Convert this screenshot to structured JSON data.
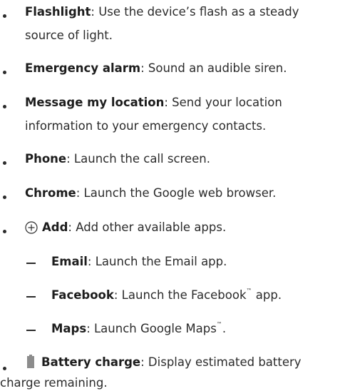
{
  "items": [
    {
      "term": "Flashlight",
      "desc_line1": ": Use the device’s flash as a steady",
      "desc_line2": "source of light."
    },
    {
      "term": "Emergency alarm",
      "desc_line1": ": Sound an audible siren."
    },
    {
      "term": "Message my location",
      "desc_line1": ": Send your location",
      "desc_line2": "information to your emergency contacts."
    },
    {
      "term": "Phone",
      "desc_line1": ": Launch the call screen."
    },
    {
      "term": "Chrome",
      "desc_line1": ": Launch the Google web browser."
    },
    {
      "icon": "add-circle-icon",
      "term": "Add",
      "desc_line1": ": Add other available apps."
    }
  ],
  "sub_items": [
    {
      "term": "Email",
      "desc_line1": ": Launch the Email app."
    },
    {
      "term": "Facebook",
      "desc_pre": ": Launch the Facebook",
      "desc_tm": "™",
      "desc_post": " app."
    },
    {
      "term": "Maps",
      "desc_pre": ": Launch Google Maps",
      "desc_tm": "™",
      "desc_post": "."
    }
  ],
  "battery_item": {
    "icon": "battery-icon",
    "term": "Battery charge",
    "desc_line1": ": Display estimated battery",
    "desc_line2": "charge remaining."
  },
  "colors": {
    "text": "#2b2b2b",
    "battery_icon": "#8c8c8c"
  }
}
